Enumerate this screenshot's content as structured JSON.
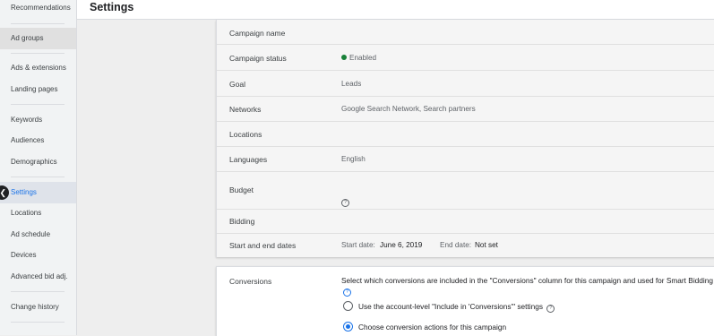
{
  "sidebar": {
    "items": [
      {
        "label": "Recommendations"
      },
      {
        "label": "Ad groups"
      },
      {
        "label": "Ads & extensions"
      },
      {
        "label": "Landing pages"
      },
      {
        "label": "Keywords"
      },
      {
        "label": "Audiences"
      },
      {
        "label": "Demographics"
      },
      {
        "label": "Settings"
      },
      {
        "label": "Locations"
      },
      {
        "label": "Ad schedule"
      },
      {
        "label": "Devices"
      },
      {
        "label": "Advanced bid adj."
      },
      {
        "label": "Change history"
      }
    ],
    "collapse_glyph": "❮"
  },
  "header": {
    "title": "Settings"
  },
  "settings": {
    "campaign_name": {
      "label": "Campaign name"
    },
    "campaign_status": {
      "label": "Campaign status",
      "value": "Enabled",
      "status_color": "#188038"
    },
    "goal": {
      "label": "Goal",
      "value": "Leads"
    },
    "networks": {
      "label": "Networks",
      "value": "Google Search Network, Search partners"
    },
    "locations": {
      "label": "Locations"
    },
    "languages": {
      "label": "Languages",
      "value": "English"
    },
    "budget": {
      "label": "Budget",
      "help_icon": "?"
    },
    "bidding": {
      "label": "Bidding"
    },
    "dates": {
      "label": "Start and end dates",
      "start_label": "Start date:",
      "start_value": "June 6, 2019",
      "end_label": "End date:",
      "end_value": "Not set"
    }
  },
  "conversions": {
    "label": "Conversions",
    "description": "Select which conversions are included in the \"Conversions\" column for this campaign and used for Smart Bidding",
    "help_icon": "?",
    "options": [
      {
        "label": "Use the account-level \"Include in 'Conversions'\" settings",
        "checked": false,
        "help_icon": "?"
      },
      {
        "label": "Choose conversion actions for this campaign",
        "checked": true
      }
    ]
  },
  "colors": {
    "accent": "#1a73e8",
    "enabled": "#188038"
  }
}
